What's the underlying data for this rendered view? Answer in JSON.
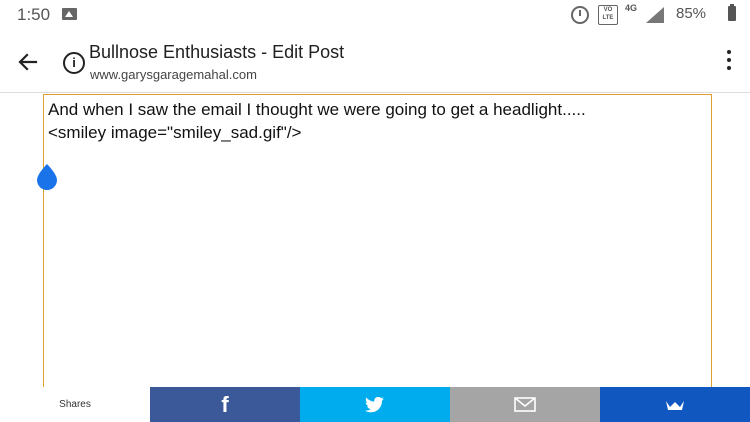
{
  "status_bar": {
    "time": "1:50",
    "volte_label": "VO LTE",
    "network": "4G",
    "battery": "85%"
  },
  "app_bar": {
    "title": "Bullnose Enthusiasts - Edit Post",
    "url": "www.garysgaragemahal.com"
  },
  "editor": {
    "text": "And when I saw the email I thought we were going to get a headlight.....\n<smiley image=\"smiley_sad.gif\"/>"
  },
  "share_bar": {
    "label": "Shares",
    "buttons": [
      {
        "name": "facebook",
        "color": "#3b5998"
      },
      {
        "name": "twitter",
        "color": "#00aced"
      },
      {
        "name": "email",
        "color": "#a5a5a5"
      },
      {
        "name": "sumo",
        "color": "#1058c0"
      }
    ]
  },
  "colors": {
    "editor_border": "#e0a030",
    "cursor_handle": "#1a73e8"
  }
}
